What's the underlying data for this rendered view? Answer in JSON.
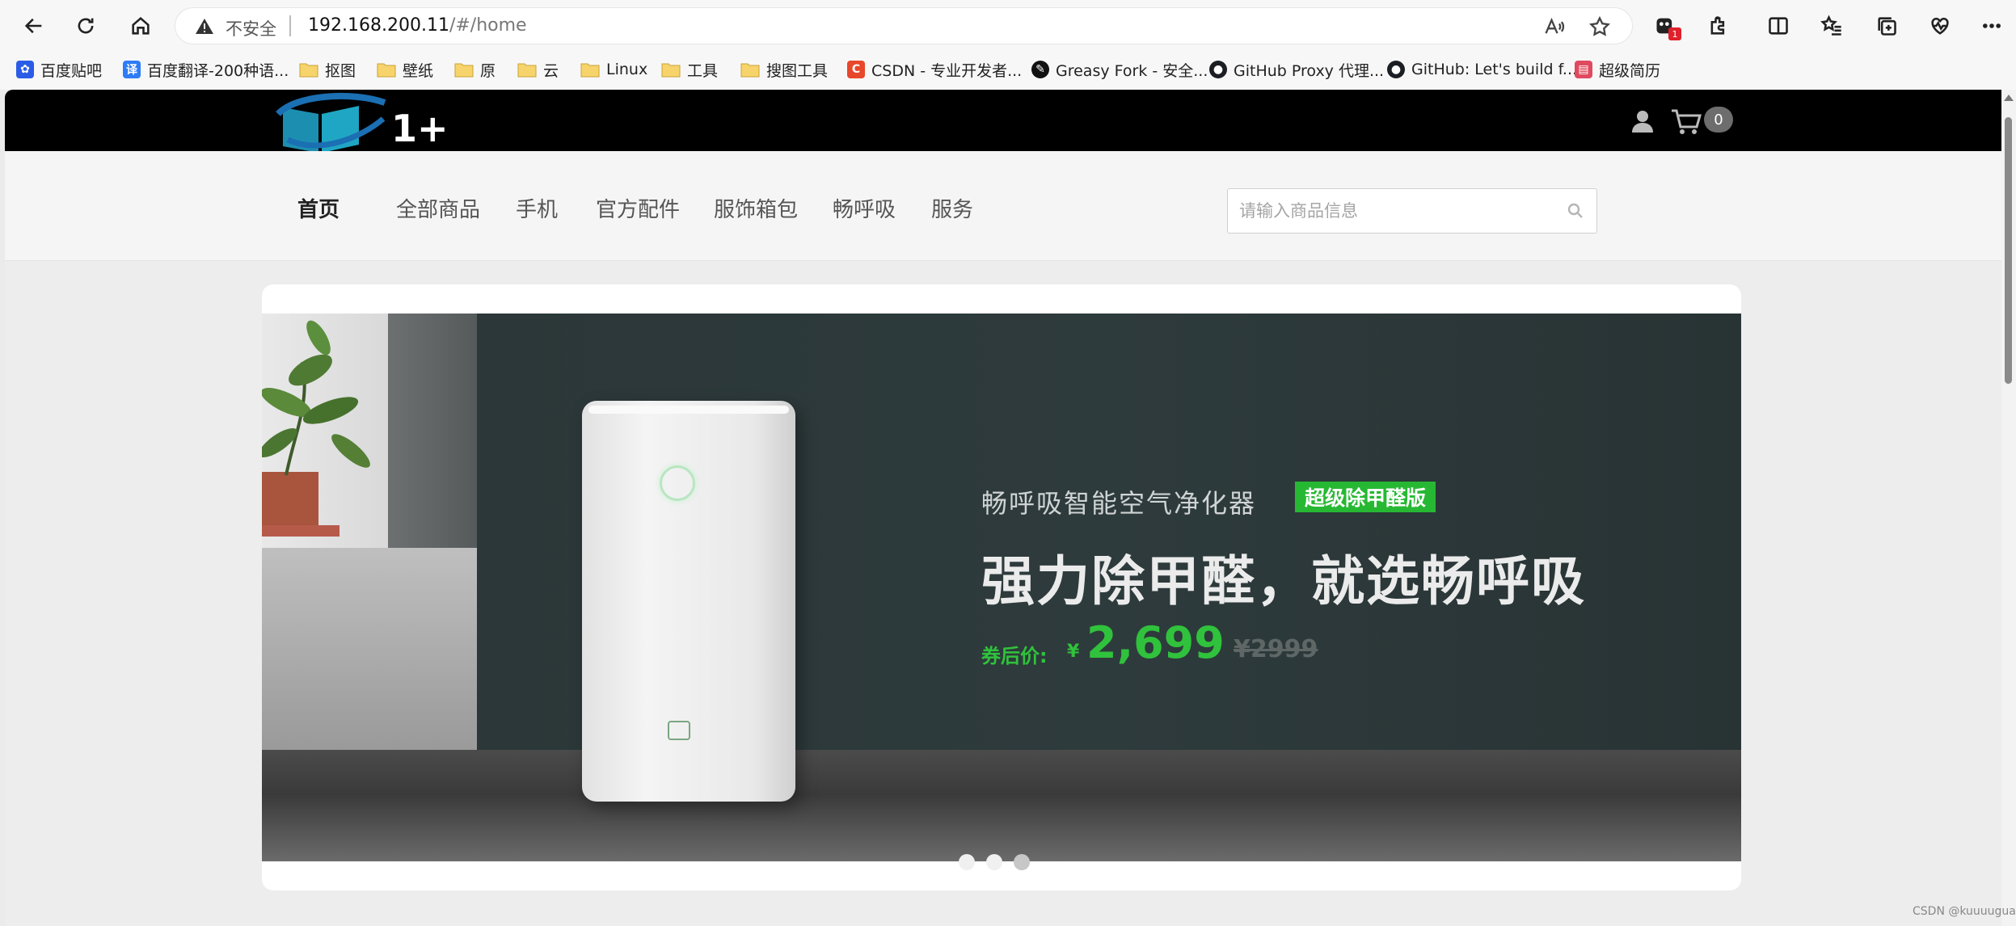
{
  "browser": {
    "security_label": "不安全",
    "url_host": "192.168.200.11",
    "url_path": "/#/home",
    "extension_badge": "1"
  },
  "bookmarks": [
    {
      "label": "百度贴吧",
      "icon": "baidu-paw-icon"
    },
    {
      "label": "百度翻译-200种语...",
      "icon": "baidu-translate-icon"
    },
    {
      "label": "抠图",
      "icon": "folder-icon"
    },
    {
      "label": "壁纸",
      "icon": "folder-icon"
    },
    {
      "label": "原",
      "icon": "folder-icon"
    },
    {
      "label": "云",
      "icon": "folder-icon"
    },
    {
      "label": "Linux",
      "icon": "folder-icon"
    },
    {
      "label": "工具",
      "icon": "folder-icon"
    },
    {
      "label": "搜图工具",
      "icon": "folder-icon"
    },
    {
      "label": "CSDN - 专业开发者...",
      "icon": "csdn-icon"
    },
    {
      "label": "Greasy Fork - 安全...",
      "icon": "greasyfork-icon"
    },
    {
      "label": "GitHub Proxy 代理...",
      "icon": "github-icon"
    },
    {
      "label": "GitHub: Let's build f...",
      "icon": "github-icon"
    },
    {
      "label": "超级简历",
      "icon": "resume-icon"
    }
  ],
  "site": {
    "logo_text": "1+",
    "cart_count": "0",
    "nav": [
      "首页",
      "全部商品",
      "手机",
      "官方配件",
      "服饰箱包",
      "畅呼吸",
      "服务"
    ],
    "search_placeholder": "请输入商品信息"
  },
  "banner": {
    "line1": "畅呼吸智能空气净化器",
    "tag": "超级除甲醛版",
    "headline": "强力除甲醛，就选畅呼吸",
    "price_label": "券后价:",
    "currency": "¥",
    "price": "2,699",
    "old_price": "¥2999",
    "slide_count": 3,
    "active_slide": 3
  },
  "watermark": "CSDN @kuuuugua",
  "colors": {
    "accent_green": "#30c23c",
    "tag_green": "#27b833",
    "site_header": "#000000"
  }
}
